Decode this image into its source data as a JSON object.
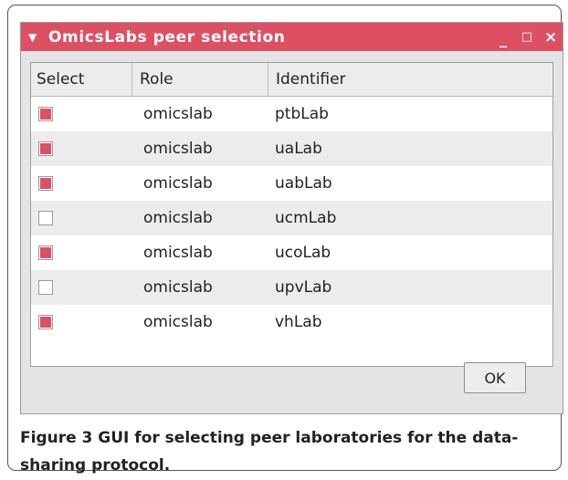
{
  "window": {
    "title": "OmicsLabs peer selection",
    "menu_icon": "triangle-down-icon",
    "controls": {
      "minimize": "_",
      "maximize": "□",
      "close": "×"
    },
    "accent_color": "#dd5064"
  },
  "table": {
    "columns": [
      "Select",
      "Role",
      "Identifier"
    ],
    "rows": [
      {
        "selected": true,
        "role": "omicslab",
        "identifier": "ptbLab"
      },
      {
        "selected": true,
        "role": "omicslab",
        "identifier": "uaLab"
      },
      {
        "selected": true,
        "role": "omicslab",
        "identifier": "uabLab"
      },
      {
        "selected": false,
        "role": "omicslab",
        "identifier": "ucmLab"
      },
      {
        "selected": true,
        "role": "omicslab",
        "identifier": "ucoLab"
      },
      {
        "selected": false,
        "role": "omicslab",
        "identifier": "upvLab"
      },
      {
        "selected": true,
        "role": "omicslab",
        "identifier": "vhLab"
      }
    ]
  },
  "ok_button": {
    "label": "OK"
  },
  "caption": {
    "label": "Figure 3",
    "text": " GUI for selecting peer laboratories for the data-sharing protocol."
  }
}
